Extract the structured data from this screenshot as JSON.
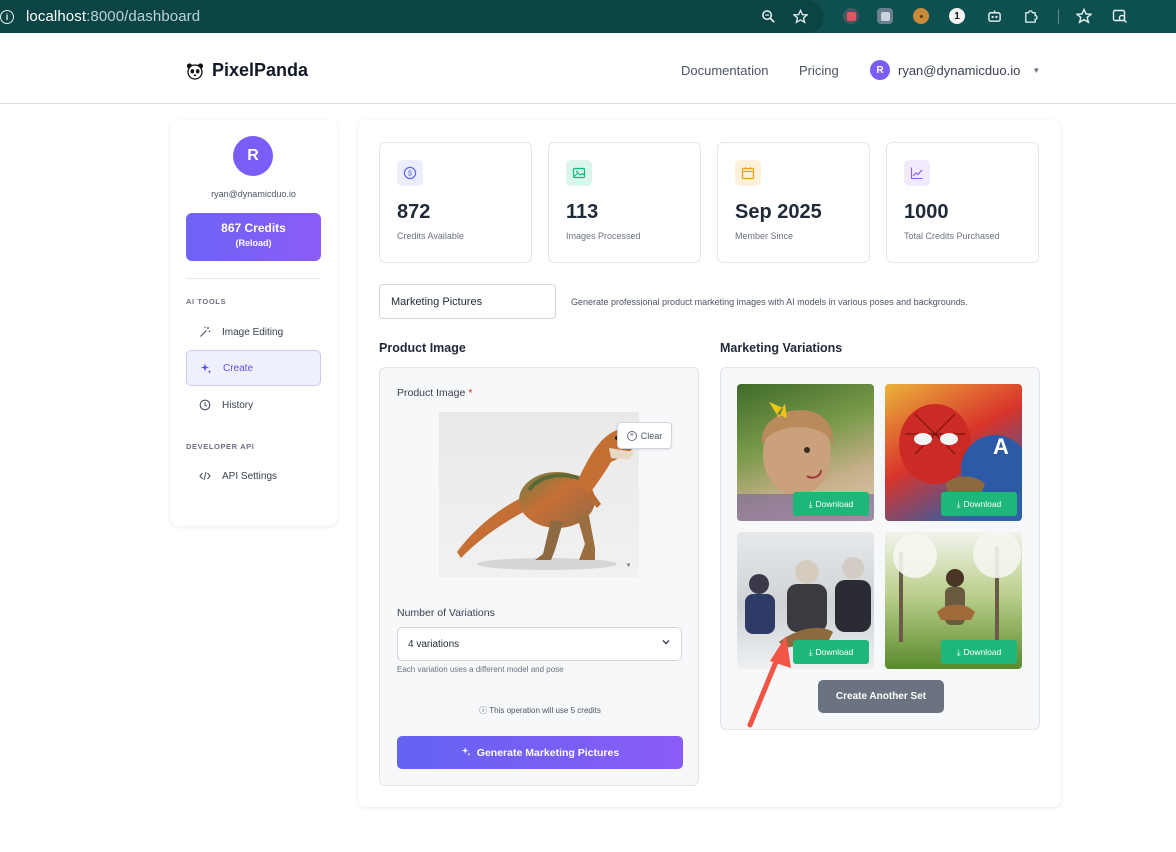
{
  "browser": {
    "url_host": "localhost",
    "url_path": ":8000/dashboard",
    "icons": [
      "info-icon",
      "zoom-icon",
      "star-icon",
      "extension-icons",
      "bookmark-star-icon",
      "tab-search-icon"
    ]
  },
  "header": {
    "logo_text": "PixelPanda",
    "nav": {
      "documentation": "Documentation",
      "pricing": "Pricing"
    },
    "user_initial": "R",
    "user_email": "ryan@dynamicduo.io"
  },
  "sidebar": {
    "avatar_initial": "R",
    "email": "ryan@dynamicduo.io",
    "credits_label": "867 Credits",
    "reload_label": "(Reload)",
    "section_ai_tools": "AI TOOLS",
    "items": [
      {
        "label": "Image Editing",
        "icon": "magic-wand-icon"
      },
      {
        "label": "Create",
        "icon": "sparkles-icon"
      },
      {
        "label": "History",
        "icon": "clock-icon"
      }
    ],
    "section_developer": "DEVELOPER API",
    "api_item": {
      "label": "API Settings",
      "icon": "code-icon"
    }
  },
  "stats": [
    {
      "value": "872",
      "label": "Credits Available",
      "icon": "dollar-coin-icon",
      "color": "#6366f1"
    },
    {
      "value": "113",
      "label": "Images Processed",
      "icon": "image-icon",
      "color": "#10b981"
    },
    {
      "value": "Sep 2025",
      "label": "Member Since",
      "icon": "calendar-icon",
      "color": "#f59e0b"
    },
    {
      "value": "1000",
      "label": "Total Credits Purchased",
      "icon": "chart-line-icon",
      "color": "#8b5cf6"
    }
  ],
  "tool": {
    "selected": "Marketing Pictures",
    "description": "Generate professional product marketing images with AI models in various poses and backgrounds."
  },
  "product": {
    "section_title": "Product Image",
    "field_label": "Product Image",
    "required_mark": "*",
    "clear_label": "Clear",
    "variations_label": "Number of Variations",
    "variations_value": "4 variations",
    "variations_hint": "Each variation uses a different model and pose",
    "cost_note": "This operation will use 5 credits",
    "generate_label": "Generate Marketing Pictures"
  },
  "variations": {
    "section_title": "Marketing Variations",
    "download_label": "Download",
    "another_label": "Create Another Set"
  },
  "colors": {
    "accent": "#7c5cf6",
    "download_green": "#1fb67a",
    "browser_bar": "#0e4f4f",
    "annotation_arrow": "#f05545"
  }
}
